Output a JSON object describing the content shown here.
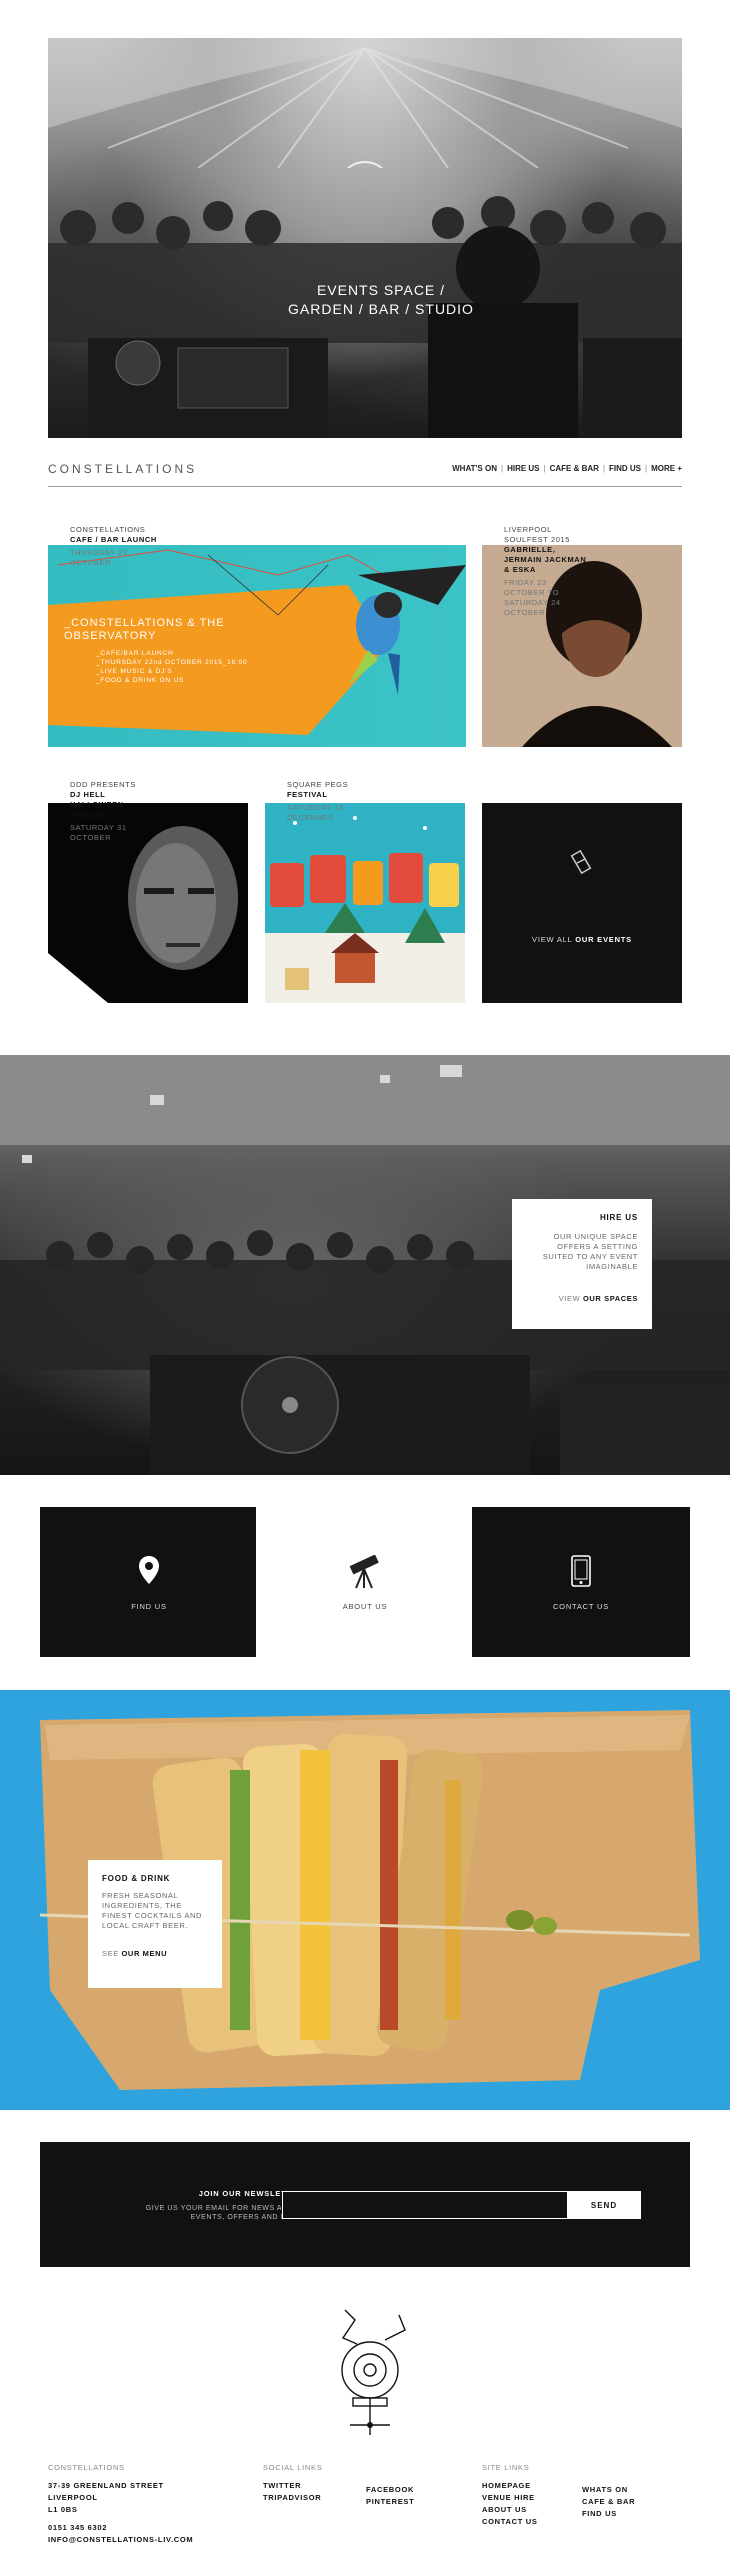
{
  "hero": {
    "headline": "EVENTS SPACE / GARDEN / BAR / STUDIO"
  },
  "header": {
    "brand": "CONSTELLATIONS",
    "nav": [
      "WHAT'S ON",
      "HIRE US",
      "CAFE & BAR",
      "FIND US",
      "MORE +"
    ],
    "separator": "|"
  },
  "events": [
    {
      "title": "CONSTELLATIONS",
      "name": "CAFE / BAR LAUNCH",
      "date": "THURSDAY 22 OCTOBER",
      "poster": {
        "title": "_CONSTELLATIONS & THE OBSERVATORY",
        "lines": [
          "_CAFE/BAR LAUNCH",
          "_THURSDAY 22nd OCTOBER 2015_16:00",
          "_LIVE MUSIC & DJ'S",
          "_FOOD & DRINK ON US"
        ]
      }
    },
    {
      "title": "LIVERPOOL SOULFEST 2015",
      "name": "GABRIELLE, JERMAIN JACKMAN & ESKA",
      "date": "FRIDAY 23 OCTOBER TO SATURDAY 24 OCTOBER"
    },
    {
      "title": "DDD PRESENTS",
      "name": "DJ HELL HALLOWEEN SPECIAL",
      "date": "SATURDAY 31 OCTOBER"
    },
    {
      "title": "SQUARE PEGS",
      "name": "FESTIVAL",
      "date": "SATURDAY 12 DECEMBER"
    }
  ],
  "view_all": {
    "prefix": "VIEW ALL",
    "bold": "OUR EVENTS"
  },
  "hire": {
    "heading": "HIRE US",
    "text": "OUR UNIQUE SPACE OFFERS A SETTING SUITED TO ANY EVENT IMAGINABLE",
    "link_prefix": "VIEW",
    "link_bold": "OUR SPACES"
  },
  "tiles": {
    "find": "FIND US",
    "about": "ABOUT US",
    "contact": "CONTACT US"
  },
  "food": {
    "heading": "FOOD & DRINK",
    "text": "FRESH SEASONAL INGREDIENTS, THE FINEST COCKTAILS AND LOCAL CRAFT BEER.",
    "link_prefix": "SEE",
    "link_bold": "OUR MENU"
  },
  "newsletter": {
    "heading": "JOIN OUR NEWSLETTER",
    "text": "GIVE US YOUR EMAIL FOR NEWS ABOUT EVENTS, OFFERS AND MORE",
    "email_value": "",
    "send": "SEND"
  },
  "footer": {
    "col1": {
      "heading": "CONSTELLATIONS",
      "lines": [
        "37-39 GREENLAND STREET",
        "LIVERPOOL",
        "L1 0BS",
        "",
        "0151 345 6302",
        "INFO@CONSTELLATIONS-LIV.COM"
      ]
    },
    "social": {
      "heading": "SOCIAL LINKS",
      "left": [
        "TWITTER",
        "TRIPADVISOR"
      ],
      "right": [
        "FACEBOOK",
        "PINTEREST"
      ]
    },
    "site": {
      "heading": "SITE LINKS",
      "left": [
        "HOMEPAGE",
        "VENUE HIRE",
        "ABOUT US",
        "CONTACT US"
      ],
      "right": [
        "WHATS ON",
        "CAFE & BAR",
        "FIND US"
      ]
    }
  },
  "colors": {
    "teal": "#34bcc1",
    "orange": "#f39a1f",
    "blue": "#2fa3de",
    "black": "#111111"
  }
}
